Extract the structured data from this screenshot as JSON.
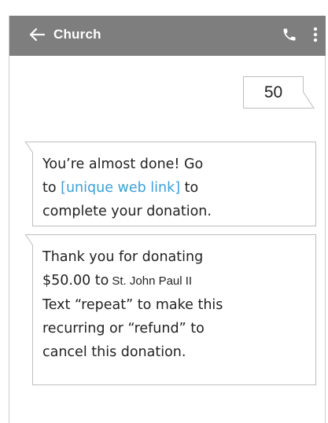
{
  "header": {
    "title": "Church",
    "back_icon": "arrow-left-icon",
    "call_icon": "phone-icon",
    "menu_icon": "more-vertical-icon",
    "background_color": "#7e7e7e"
  },
  "messages": {
    "sent": {
      "text": "50"
    },
    "received": [
      {
        "line1": "You’re almost done! Go",
        "line2_prefix": "to ",
        "link_text": "[unique web link]",
        "line2_suffix": " to",
        "line3": "complete your donation."
      },
      {
        "line1": "Thank you for donating",
        "amount_text": "$50.00 to",
        "church_name": "St. John Paul II",
        "line3": "Text “repeat” to make this",
        "line4": "recurring or “refund” to",
        "line5": "cancel this donation."
      }
    ]
  },
  "colors": {
    "link": "#3aa0d8",
    "bubble_border": "#bdbdbd",
    "text": "#222222"
  }
}
